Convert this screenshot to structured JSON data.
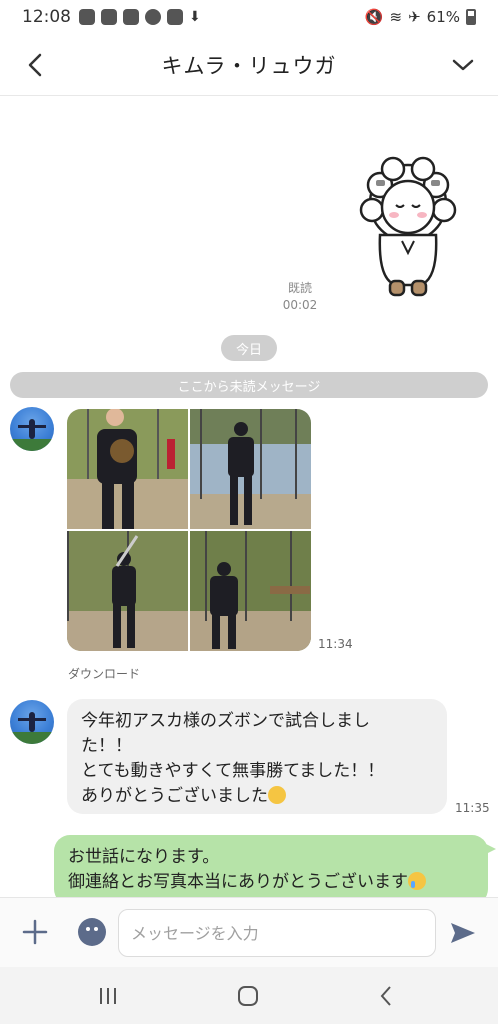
{
  "status_bar": {
    "time": "12:08",
    "battery": "61%"
  },
  "header": {
    "title": "キムラ・リュウガ"
  },
  "chat": {
    "read_status": "既読",
    "read_time": "00:02",
    "date_divider": "今日",
    "unread_divider": "ここから未読メッセージ",
    "photo_time": "11:34",
    "download_label": "ダウンロード",
    "incoming_lines": [
      "今年初アスカ様のズボンで試合しまし",
      "た！！",
      "とても動きやすくて無事勝てました！！",
      "ありがとうございました"
    ],
    "incoming_time": "11:35",
    "outgoing_lines": [
      "お世話になります。",
      "御連絡とお写真本当にありがとうございます"
    ]
  },
  "input": {
    "placeholder": "メッセージを入力"
  },
  "colors": {
    "outgoing_bubble": "#b6e3a8",
    "incoming_bubble": "#f0f0f0",
    "divider_pill": "#cfcfcf"
  },
  "icons": {
    "back": "chevron-left-icon",
    "menu": "chevron-down-icon",
    "plus": "plus-icon",
    "emoji": "emoji-icon",
    "send": "send-icon",
    "nav_recents": "recents-icon",
    "nav_home": "home-icon",
    "nav_back": "back-icon"
  }
}
